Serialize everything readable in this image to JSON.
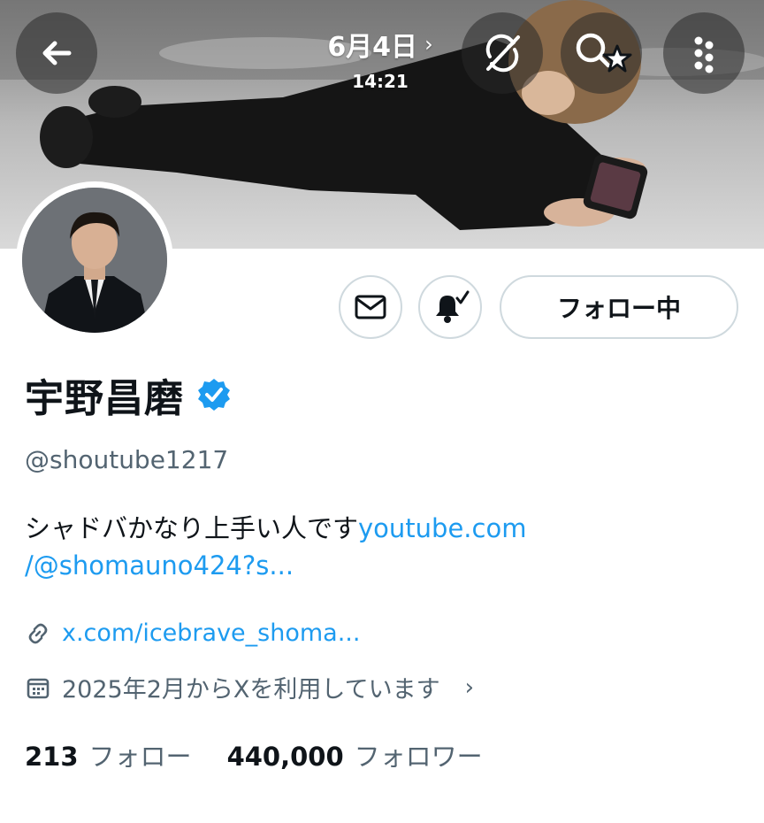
{
  "header": {
    "date": "6月4日",
    "time": "14:21",
    "icons": [
      "back-arrow-icon",
      "sync-off-icon",
      "search-star-icon",
      "more-vertical-icon"
    ]
  },
  "profile": {
    "display_name": "宇野昌磨",
    "verified": true,
    "handle": "@shoutube1217",
    "bio_text": "シャドバかなり上手い人です",
    "bio_link_line1": "youtube.com",
    "bio_link_line2": "/@shomauno424?s...",
    "website": "x.com/icebrave_shoma...",
    "joined": "2025年2月からXを利用しています"
  },
  "actions": {
    "follow_label": "フォロー中",
    "icons": [
      "mail-icon",
      "bell-checked-icon"
    ]
  },
  "stats": {
    "following_count": "213",
    "following_label": "フォロー",
    "followers_count": "440,000",
    "followers_label": "フォロワー"
  },
  "colors": {
    "accent": "#1d9bf0",
    "text": "#0f1419",
    "muted": "#536471",
    "border": "#cfd9de"
  }
}
